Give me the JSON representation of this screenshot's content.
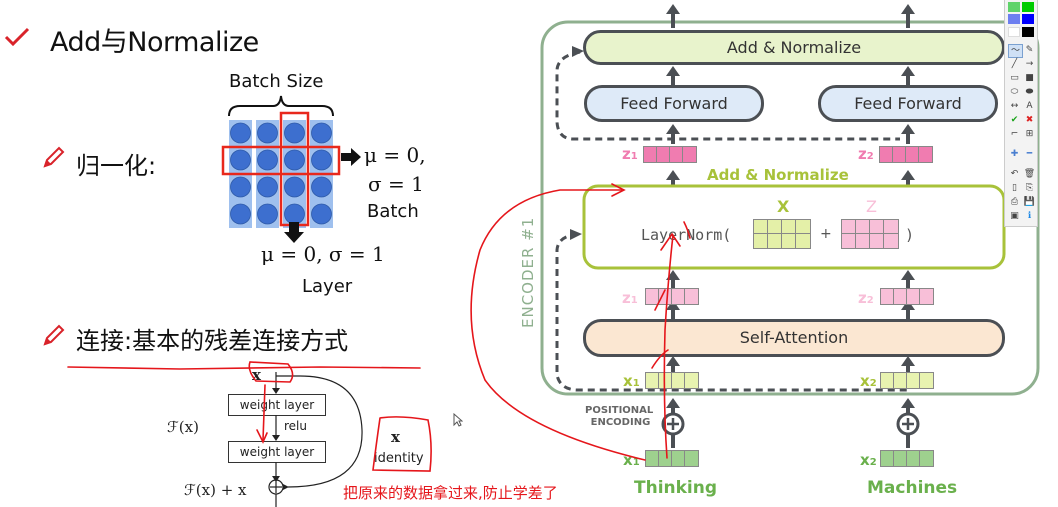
{
  "slide": {
    "title": "Add与Normalize",
    "bullet1": {
      "label": "归一化:",
      "figure": {
        "batch_size_label": "Batch Size",
        "grid_rows": 4,
        "grid_cols": 4,
        "right_formula_line1": "μ = 0,",
        "right_formula_line2": "σ = 1",
        "right_label": "Batch",
        "bottom_formula": "μ = 0, σ = 1",
        "bottom_label": "Layer"
      }
    },
    "bullet2": {
      "label": "连接:基本的残差连接方式",
      "residual_figure": {
        "input": "x",
        "layer1": "weight layer",
        "activation": "relu",
        "layer2": "weight layer",
        "fx_label": "ℱ(x)",
        "output_label": "ℱ(x) + x",
        "identity_x": "x",
        "identity_label": "identity"
      }
    },
    "annotation_text": "把原来的数据拿过来,防止学差了"
  },
  "encoder": {
    "side_label": "ENCODER #1",
    "top_block": "Add & Normalize",
    "ffn_left": "Feed Forward",
    "ffn_right": "Feed Forward",
    "z1_label": "z",
    "z2_label": "z",
    "mid_title": "Add & Normalize",
    "layernorm_prefix": "LayerNorm(",
    "layernorm_plus": "+",
    "layernorm_suffix": ")",
    "x_matrix_label": "X",
    "z_matrix_label": "Z",
    "self_attention": "Self-Attention",
    "x1_label": "x",
    "x2_label": "x",
    "sub1": "1",
    "sub2": "2",
    "positional_encoding_line1": "POSITIONAL",
    "positional_encoding_line2": "ENCODING",
    "word1": "Thinking",
    "word2": "Machines"
  },
  "colors": {
    "check_red": "#d9232a",
    "annotation_red": "#e5161b",
    "encoder_border": "#8fb08f",
    "add_norm_fill": "#e8f3cc",
    "add_norm_green": "#a8c23a",
    "ffn_fill": "#deeaf8",
    "self_attn_fill": "#fbe7d2",
    "pink": "#f07cb0",
    "pink_light": "#f8bfd8",
    "word_green": "#6ab04c",
    "grid_blue": "#3d6fcf"
  },
  "toolbar": {
    "tools": [
      "freehand",
      "eraser",
      "line",
      "arrow",
      "rectangle",
      "filled-rectangle",
      "ellipse",
      "filled-ellipse",
      "double-arrow",
      "text",
      "check",
      "cross",
      "crop",
      "zoom-rect",
      "plus",
      "minus",
      "undo",
      "delete",
      "new-page",
      "copy",
      "print",
      "save",
      "screen",
      "info"
    ]
  }
}
